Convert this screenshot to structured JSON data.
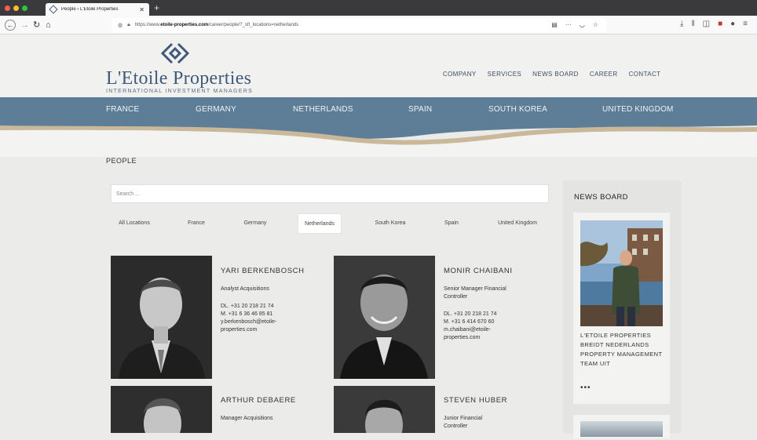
{
  "browser": {
    "tab_title": "People › L'Etoile Properties",
    "url_prefix": "https://www.",
    "url_domain": "etoile-properties.com",
    "url_path": "/career/people/?_sft_locations=netherlands"
  },
  "site": {
    "logo_name": "L'Etoile Properties",
    "logo_tagline": "INTERNATIONAL INVESTMENT MANAGERS",
    "top_nav": [
      "COMPANY",
      "SERVICES",
      "NEWS BOARD",
      "CAREER",
      "CONTACT"
    ],
    "countries": [
      "FRANCE",
      "GERMANY",
      "NETHERLANDS",
      "SPAIN",
      "SOUTH KOREA",
      "UNITED KINGDOM"
    ],
    "brand_color": "#5d7e96",
    "accent_color": "#c9b89a"
  },
  "main": {
    "page_title": "PEOPLE",
    "search_placeholder": "Search ...",
    "filters": [
      "All Locations",
      "France",
      "Germany",
      "Netherlands",
      "South Korea",
      "Spain",
      "United Kingdom"
    ],
    "active_filter": "Netherlands",
    "people": [
      {
        "name": "YARI BERKENBOSCH",
        "role": "Analyst Acquisitions",
        "dl": "DL. +31 20 218 21 74",
        "mobile": "M. +31 6 36 46 85 81",
        "email_1": "y.berkenbosch@etoile-",
        "email_2": "properties.com"
      },
      {
        "name": "MONIR CHAIBANI",
        "role_1": "Senior Manager Financial",
        "role_2": "Controller",
        "dl": "DL. +31 20 218 21 74",
        "mobile": "M. +31 6 414 670 60",
        "email": "m.chaibani@etoile-properties.com"
      },
      {
        "name": "ARTHUR DEBAERE",
        "role": "Manager Acquisitions"
      },
      {
        "name": "STEVEN HUBER",
        "role": "Junior Financial Controller"
      }
    ]
  },
  "sidebar": {
    "title": "NEWS BOARD",
    "news_text": "L'ETOILE PROPERTIES BREIDT NEDERLANDS PROPERTY MANAGEMENT TEAM UIT",
    "more_dots": "•••"
  }
}
